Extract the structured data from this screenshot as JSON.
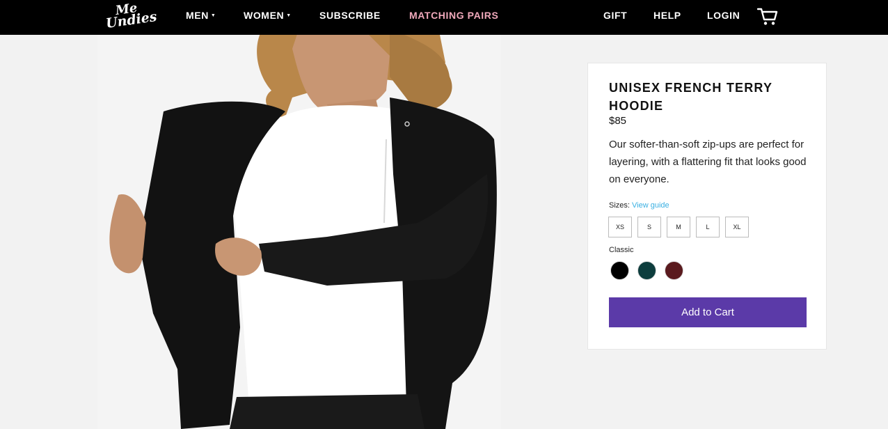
{
  "nav": {
    "logo_line1": "Me",
    "logo_line2": "Undies",
    "items": [
      {
        "label": "MEN",
        "caret": "▼"
      },
      {
        "label": "WOMEN",
        "caret": "▼"
      },
      {
        "label": "SUBSCRIBE"
      },
      {
        "label": "MATCHING PAIRS"
      },
      {
        "label": "GIFT"
      },
      {
        "label": "HELP"
      },
      {
        "label": "LOGIN"
      }
    ],
    "cart_icon": "cart-icon",
    "accent_color": "#f0a9bb"
  },
  "product": {
    "title": "UNISEX FRENCH TERRY HOODIE",
    "price": "$85",
    "description": "Our softer-than-soft zip-ups are perfect for layering, with a flattering fit that looks good on everyone.",
    "sizes_label": "Sizes:",
    "view_guide": "View guide",
    "sizes": [
      "XS",
      "S",
      "M",
      "L",
      "XL"
    ],
    "color_group_label": "Classic",
    "swatches": [
      "#000000",
      "#0d3d3d",
      "#5a1a1e"
    ],
    "add_to_cart": "Add to Cart",
    "button_color": "#5b3aa8"
  }
}
